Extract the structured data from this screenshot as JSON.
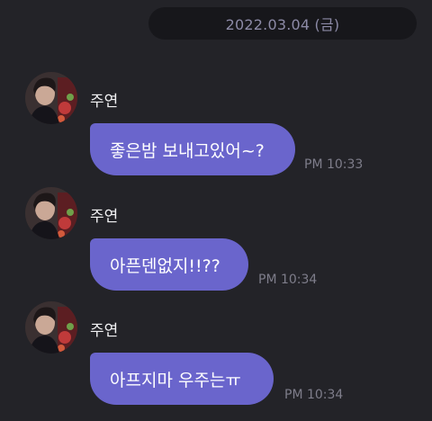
{
  "date_divider": "2022.03.04 (금)",
  "messages": [
    {
      "sender": "주연",
      "text": "좋은밤 보내고있어~?",
      "time": "PM 10:33"
    },
    {
      "sender": "주연",
      "text": "아픈덴없지!!??",
      "time": "PM 10:34"
    },
    {
      "sender": "주연",
      "text": "아프지마 우주는ㅠ",
      "time": "PM 10:34"
    }
  ],
  "colors": {
    "background": "#232328",
    "date_pill": "#17171b",
    "bubble": "#6a65cc",
    "timestamp": "#7e7d8a"
  },
  "icons": {
    "avatar": "profile-photo"
  }
}
